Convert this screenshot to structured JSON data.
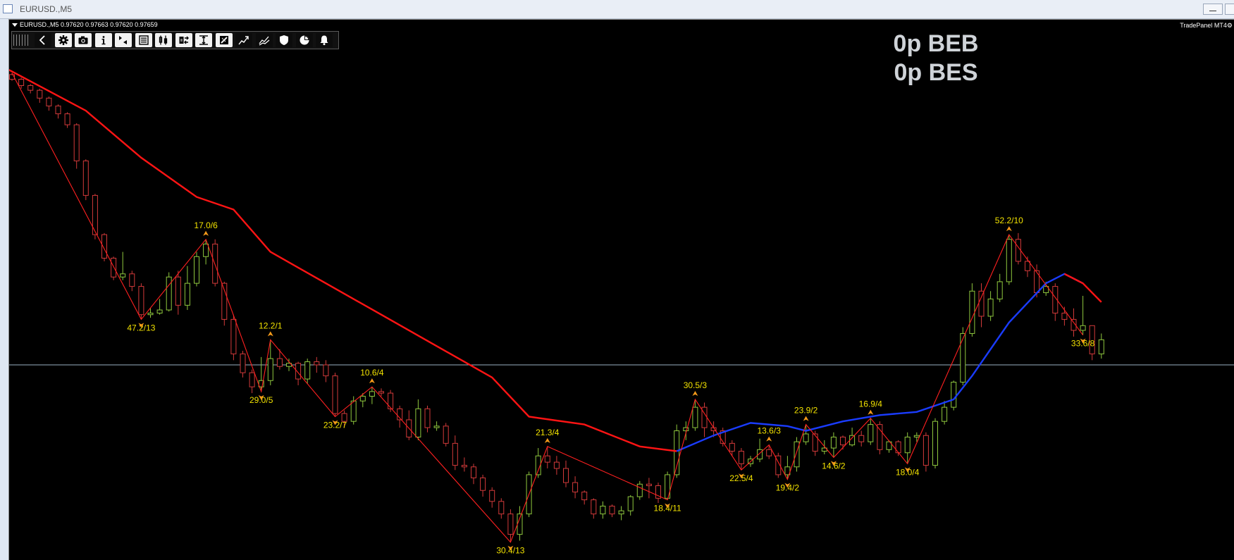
{
  "window": {
    "title": "EURUSD.,M5"
  },
  "chart": {
    "header": "EURUSD.,M5  0.97620 0.97663 0.97620 0.97659",
    "panel_name": "TradePanel MT4",
    "break_even_buy": "0p BEB",
    "break_even_sell": "0p BES"
  },
  "toolbar": {
    "icons": [
      "grip-icon",
      "back-arrow-icon",
      "gear-icon",
      "camera-icon",
      "info-icon",
      "play-icon",
      "list-icon",
      "chart-bars-icon",
      "swap-icon",
      "range-icon",
      "ruler-icon",
      "trend-up-icon",
      "trend-multi-icon",
      "shield-icon",
      "pie-chart-icon",
      "bell-icon"
    ]
  },
  "colors": {
    "bull_candle": "#8fc73e",
    "bear_candle": "#d23a3a",
    "zigzag": "#ff2020",
    "ma_red": "#ff1414",
    "ma_blue": "#1a3cff",
    "label": "#f2e200",
    "arrow": "#f59a1a",
    "hline": "#9ab0c2"
  },
  "chart_data": {
    "type": "candlestick",
    "title": "EURUSD.,M5",
    "last_quote": {
      "open": 0.9762,
      "high": 0.97663,
      "low": 0.9762,
      "close": 0.97659
    },
    "zigzag_labels": [
      {
        "text": "47.2/13",
        "index": 14,
        "kind": "low"
      },
      {
        "text": "17.0/6",
        "index": 21,
        "kind": "high"
      },
      {
        "text": "29.0/5",
        "index": 27,
        "kind": "low"
      },
      {
        "text": "12.2/1",
        "index": 28,
        "kind": "high"
      },
      {
        "text": "23.2/7",
        "index": 35,
        "kind": "low"
      },
      {
        "text": "10.6/4",
        "index": 39,
        "kind": "high"
      },
      {
        "text": "30.4/13",
        "index": 54,
        "kind": "low"
      },
      {
        "text": "21.3/4",
        "index": 58,
        "kind": "high"
      },
      {
        "text": "18.4/11",
        "index": 71,
        "kind": "low"
      },
      {
        "text": "30.5/3",
        "index": 74,
        "kind": "high"
      },
      {
        "text": "22.5/4",
        "index": 79,
        "kind": "low"
      },
      {
        "text": "13.6/3",
        "index": 82,
        "kind": "high"
      },
      {
        "text": "19.4/2",
        "index": 84,
        "kind": "low"
      },
      {
        "text": "23.9/2",
        "index": 86,
        "kind": "high"
      },
      {
        "text": "14.6/2",
        "index": 89,
        "kind": "low"
      },
      {
        "text": "16.9/4",
        "index": 93,
        "kind": "high"
      },
      {
        "text": "18.0/4",
        "index": 97,
        "kind": "low"
      },
      {
        "text": "52.2/10",
        "index": 108,
        "kind": "high"
      },
      {
        "text": "33.6/8",
        "index": 116,
        "kind": "low"
      }
    ],
    "candles": [
      [
        0.9913,
        0.9914,
        0.9909,
        0.991
      ],
      [
        0.991,
        0.9911,
        0.9904,
        0.9906
      ],
      [
        0.9906,
        0.9907,
        0.9901,
        0.9903
      ],
      [
        0.9903,
        0.9904,
        0.9895,
        0.9898
      ],
      [
        0.9898,
        0.9899,
        0.989,
        0.9893
      ],
      [
        0.9893,
        0.9894,
        0.9885,
        0.9888
      ],
      [
        0.9888,
        0.9889,
        0.9879,
        0.9881
      ],
      [
        0.9881,
        0.9882,
        0.9853,
        0.9858
      ],
      [
        0.9858,
        0.9859,
        0.9833,
        0.9836
      ],
      [
        0.9836,
        0.9837,
        0.9808,
        0.9811
      ],
      [
        0.9811,
        0.9812,
        0.9794,
        0.9796
      ],
      [
        0.9796,
        0.9797,
        0.9782,
        0.9784
      ],
      [
        0.9784,
        0.98,
        0.9782,
        0.9786
      ],
      [
        0.9786,
        0.9788,
        0.9775,
        0.9778
      ],
      [
        0.9778,
        0.978,
        0.9757,
        0.976
      ],
      [
        0.976,
        0.9764,
        0.9758,
        0.9761
      ],
      [
        0.9761,
        0.977,
        0.976,
        0.9763
      ],
      [
        0.9763,
        0.9787,
        0.9762,
        0.9784
      ],
      [
        0.9784,
        0.9788,
        0.976,
        0.9766
      ],
      [
        0.9766,
        0.9791,
        0.9763,
        0.978
      ],
      [
        0.978,
        0.98,
        0.9778,
        0.9797
      ],
      [
        0.9797,
        0.9808,
        0.9792,
        0.9805
      ],
      [
        0.9805,
        0.9808,
        0.9778,
        0.978
      ],
      [
        0.978,
        0.9781,
        0.9753,
        0.9757
      ],
      [
        0.9757,
        0.976,
        0.9731,
        0.9735
      ],
      [
        0.9735,
        0.9737,
        0.972,
        0.9723
      ],
      [
        0.9723,
        0.9725,
        0.971,
        0.9714
      ],
      [
        0.9714,
        0.9733,
        0.9711,
        0.9718
      ],
      [
        0.9718,
        0.9744,
        0.9715,
        0.9732
      ],
      [
        0.9732,
        0.9738,
        0.9725,
        0.9727
      ],
      [
        0.9727,
        0.9732,
        0.9724,
        0.9729
      ],
      [
        0.9729,
        0.973,
        0.9715,
        0.9719
      ],
      [
        0.9719,
        0.9732,
        0.9716,
        0.973
      ],
      [
        0.973,
        0.9733,
        0.9723,
        0.9728
      ],
      [
        0.9728,
        0.9731,
        0.9717,
        0.9721
      ],
      [
        0.9721,
        0.9723,
        0.9695,
        0.9697
      ],
      [
        0.9697,
        0.9699,
        0.9688,
        0.9692
      ],
      [
        0.9692,
        0.9708,
        0.969,
        0.9705
      ],
      [
        0.9705,
        0.971,
        0.9701,
        0.9708
      ],
      [
        0.9708,
        0.9714,
        0.9703,
        0.9711
      ],
      [
        0.9711,
        0.9713,
        0.9708,
        0.971
      ],
      [
        0.971,
        0.9712,
        0.9698,
        0.97
      ],
      [
        0.97,
        0.9702,
        0.9688,
        0.9693
      ],
      [
        0.9693,
        0.9699,
        0.968,
        0.9682
      ],
      [
        0.9682,
        0.9706,
        0.968,
        0.97
      ],
      [
        0.97,
        0.9702,
        0.9685,
        0.9688
      ],
      [
        0.9688,
        0.9692,
        0.9686,
        0.9689
      ],
      [
        0.9689,
        0.9691,
        0.9676,
        0.9678
      ],
      [
        0.9678,
        0.9683,
        0.9661,
        0.9664
      ],
      [
        0.9664,
        0.9669,
        0.966,
        0.9663
      ],
      [
        0.9663,
        0.9665,
        0.9652,
        0.9656
      ],
      [
        0.9656,
        0.9658,
        0.9644,
        0.9648
      ],
      [
        0.9648,
        0.965,
        0.9637,
        0.9641
      ],
      [
        0.9641,
        0.9643,
        0.963,
        0.9633
      ],
      [
        0.9633,
        0.9636,
        0.9615,
        0.962
      ],
      [
        0.962,
        0.9638,
        0.9616,
        0.9633
      ],
      [
        0.9633,
        0.966,
        0.9631,
        0.9658
      ],
      [
        0.9658,
        0.9675,
        0.9656,
        0.967
      ],
      [
        0.967,
        0.9676,
        0.9662,
        0.9666
      ],
      [
        0.9666,
        0.967,
        0.9658,
        0.9662
      ],
      [
        0.9662,
        0.9667,
        0.965,
        0.9653
      ],
      [
        0.9653,
        0.9657,
        0.9643,
        0.9647
      ],
      [
        0.9647,
        0.9648,
        0.9639,
        0.9642
      ],
      [
        0.9642,
        0.9643,
        0.963,
        0.9633
      ],
      [
        0.9633,
        0.9641,
        0.963,
        0.9638
      ],
      [
        0.9638,
        0.9639,
        0.9631,
        0.9633
      ],
      [
        0.9633,
        0.9638,
        0.9629,
        0.9635
      ],
      [
        0.9635,
        0.9645,
        0.9632,
        0.9644
      ],
      [
        0.9644,
        0.9654,
        0.9642,
        0.9652
      ],
      [
        0.9652,
        0.9656,
        0.9643,
        0.9651
      ],
      [
        0.9651,
        0.9653,
        0.964,
        0.9643
      ],
      [
        0.9643,
        0.966,
        0.9642,
        0.9658
      ],
      [
        0.9658,
        0.969,
        0.9656,
        0.9686
      ],
      [
        0.9686,
        0.9692,
        0.968,
        0.9688
      ],
      [
        0.9688,
        0.9706,
        0.9686,
        0.9701
      ],
      [
        0.9701,
        0.9704,
        0.9682,
        0.9688
      ],
      [
        0.9688,
        0.9692,
        0.9682,
        0.9686
      ],
      [
        0.9686,
        0.9688,
        0.9676,
        0.9678
      ],
      [
        0.9678,
        0.968,
        0.967,
        0.9673
      ],
      [
        0.9673,
        0.9675,
        0.9661,
        0.9665
      ],
      [
        0.9665,
        0.967,
        0.9663,
        0.9668
      ],
      [
        0.9668,
        0.9681,
        0.9666,
        0.9674
      ],
      [
        0.9674,
        0.9677,
        0.9668,
        0.967
      ],
      [
        0.967,
        0.9672,
        0.9656,
        0.9658
      ],
      [
        0.9658,
        0.967,
        0.9655,
        0.9663
      ],
      [
        0.9663,
        0.9682,
        0.966,
        0.9679
      ],
      [
        0.9679,
        0.969,
        0.9677,
        0.9684
      ],
      [
        0.9684,
        0.9686,
        0.967,
        0.9673
      ],
      [
        0.9673,
        0.968,
        0.9671,
        0.9675
      ],
      [
        0.9675,
        0.9685,
        0.9669,
        0.9682
      ],
      [
        0.9682,
        0.9683,
        0.9674,
        0.9677
      ],
      [
        0.9677,
        0.9688,
        0.9676,
        0.9683
      ],
      [
        0.9683,
        0.9686,
        0.9676,
        0.9679
      ],
      [
        0.9679,
        0.9694,
        0.9677,
        0.969
      ],
      [
        0.969,
        0.9692,
        0.9671,
        0.9674
      ],
      [
        0.9674,
        0.968,
        0.9672,
        0.9679
      ],
      [
        0.9679,
        0.968,
        0.967,
        0.9672
      ],
      [
        0.9672,
        0.9685,
        0.9665,
        0.9682
      ],
      [
        0.9682,
        0.9685,
        0.9679,
        0.9683
      ],
      [
        0.9683,
        0.9685,
        0.966,
        0.9664
      ],
      [
        0.9664,
        0.9694,
        0.9662,
        0.9692
      ],
      [
        0.9692,
        0.9705,
        0.969,
        0.9701
      ],
      [
        0.9701,
        0.9718,
        0.9699,
        0.9717
      ],
      [
        0.9717,
        0.9752,
        0.9715,
        0.9748
      ],
      [
        0.9748,
        0.978,
        0.9746,
        0.9775
      ],
      [
        0.9775,
        0.978,
        0.9752,
        0.9759
      ],
      [
        0.9759,
        0.9775,
        0.9756,
        0.977
      ],
      [
        0.977,
        0.9786,
        0.9768,
        0.9781
      ],
      [
        0.9781,
        0.9811,
        0.9779,
        0.9808
      ],
      [
        0.9808,
        0.9812,
        0.9792,
        0.9794
      ],
      [
        0.9794,
        0.9797,
        0.9784,
        0.9788
      ],
      [
        0.9788,
        0.9792,
        0.9771,
        0.9774
      ],
      [
        0.9774,
        0.9781,
        0.9772,
        0.9778
      ],
      [
        0.9778,
        0.978,
        0.9756,
        0.9761
      ],
      [
        0.9761,
        0.9765,
        0.9753,
        0.9757
      ],
      [
        0.9757,
        0.9764,
        0.9746,
        0.975
      ],
      [
        0.975,
        0.9772,
        0.9747,
        0.9753
      ],
      [
        0.9753,
        0.9752,
        0.9731,
        0.9735
      ],
      [
        0.9735,
        0.9748,
        0.9732,
        0.9744
      ]
    ],
    "moving_average": {
      "red": [
        [
          -2,
          0.9921
        ],
        [
          0,
          0.9915
        ],
        [
          8,
          0.989
        ],
        [
          14,
          0.986
        ],
        [
          20,
          0.9835
        ],
        [
          24,
          0.9827
        ],
        [
          28,
          0.98
        ],
        [
          34,
          0.978
        ],
        [
          40,
          0.976
        ],
        [
          46,
          0.974
        ],
        [
          52,
          0.972
        ],
        [
          56,
          0.9695
        ],
        [
          62,
          0.969
        ],
        [
          68,
          0.9676
        ],
        [
          72,
          0.9673
        ]
      ],
      "blue": [
        [
          72,
          0.9673
        ],
        [
          76,
          0.9683
        ],
        [
          80,
          0.9691
        ],
        [
          84,
          0.9689
        ],
        [
          86,
          0.9686
        ],
        [
          90,
          0.9692
        ],
        [
          94,
          0.9696
        ],
        [
          98,
          0.9698
        ],
        [
          102,
          0.9706
        ],
        [
          104,
          0.9721
        ],
        [
          108,
          0.9755
        ],
        [
          112,
          0.978
        ],
        [
          114,
          0.9786
        ],
        [
          116,
          0.978
        ]
      ],
      "red_tail": [
        [
          114,
          0.9786
        ],
        [
          116,
          0.978
        ],
        [
          118,
          0.9768
        ]
      ]
    },
    "horizontal_line": 0.9728,
    "ylim": [
      0.9605,
      0.993
    ],
    "grid": false
  }
}
